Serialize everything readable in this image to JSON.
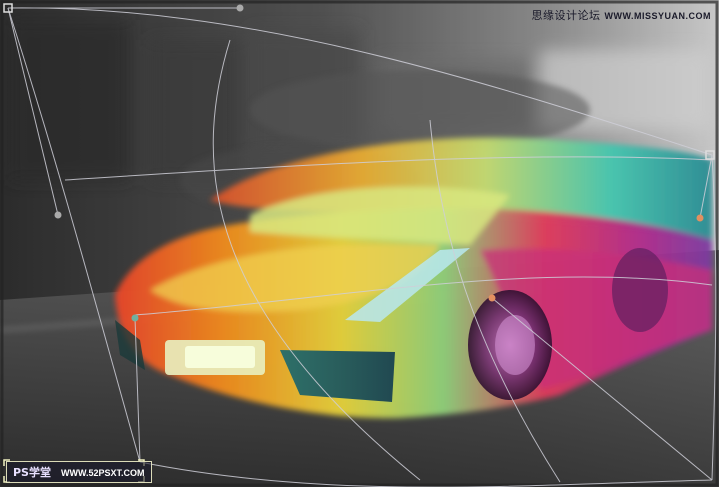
{
  "watermark_top": {
    "title": "思缘设计论坛",
    "url": "WWW.MISSYUAN.COM"
  },
  "watermark_bottom": {
    "title": "PS学堂",
    "url": "WWW.52PSXT.COM"
  },
  "colors": {
    "background_dark": "#3d3d3d",
    "road": "#4a4a4a",
    "sky_light": "#d8d8d8",
    "warp_grid": "#c8c8d0",
    "handle_fill": "#aaaaaa",
    "anchor_orange": "#e39060"
  },
  "icons": [
    "warp-grid",
    "warp-handle",
    "corner-bracket"
  ]
}
